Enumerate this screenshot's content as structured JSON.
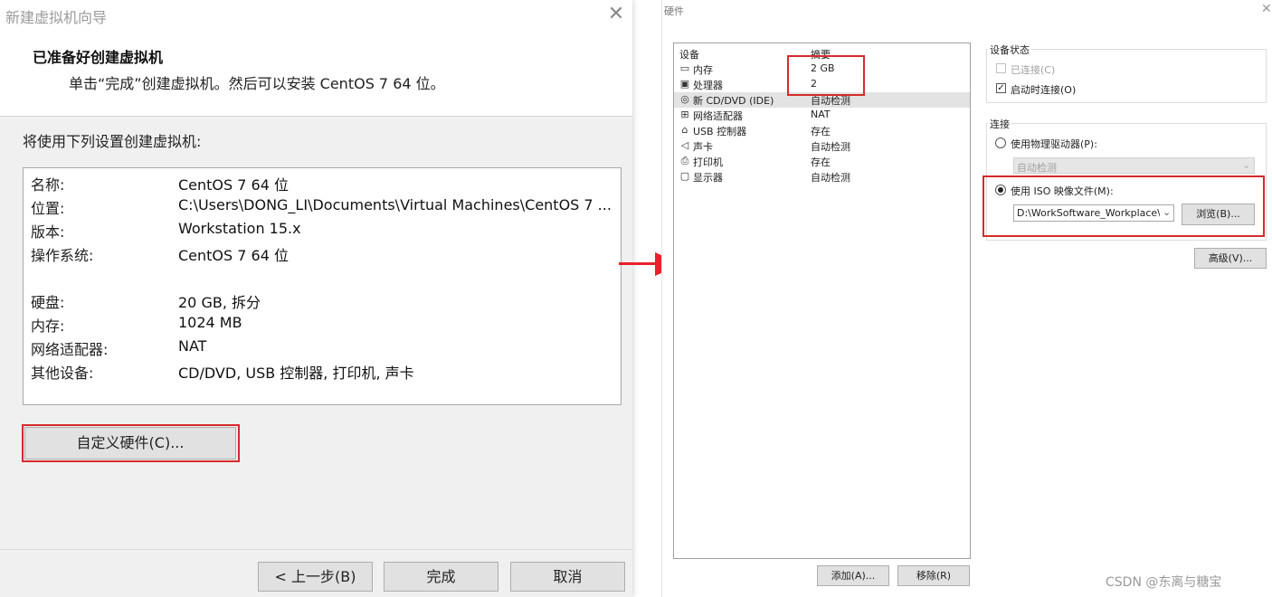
{
  "wizard": {
    "title": "新建虚拟机向导",
    "close_glyph": "✕",
    "heading": "已准备好创建虚拟机",
    "subheading": "单击“完成”创建虚拟机。然后可以安装 CentOS 7 64 位。",
    "intro": "将使用下列设置创建虚拟机:",
    "summary": [
      {
        "label": "名称:",
        "value": "CentOS 7 64 位"
      },
      {
        "label": "位置:",
        "value": "C:\\Users\\DONG_LI\\Documents\\Virtual Machines\\CentOS 7 ..."
      },
      {
        "label": "版本:",
        "value": "Workstation 15.x"
      },
      {
        "label": "操作系统:",
        "value": "CentOS 7 64 位"
      },
      {
        "label": "硬盘:",
        "value": "20 GB, 拆分"
      },
      {
        "label": "内存:",
        "value": "1024 MB"
      },
      {
        "label": "网络适配器:",
        "value": "NAT"
      },
      {
        "label": "其他设备:",
        "value": "CD/DVD, USB 控制器, 打印机, 声卡"
      }
    ],
    "customize_button": "自定义硬件(C)...",
    "back_button": "< 上一步(B)",
    "finish_button": "完成",
    "cancel_button": "取消"
  },
  "hardware": {
    "title": "硬件",
    "close_glyph": "✕",
    "columns": {
      "device": "设备",
      "summary": "摘要"
    },
    "devices": [
      {
        "icon": "memory-icon",
        "glyph": "▭",
        "name": "内存",
        "summary": "2 GB"
      },
      {
        "icon": "processor-icon",
        "glyph": "▣",
        "name": "处理器",
        "summary": "2"
      },
      {
        "icon": "cd-dvd-icon",
        "glyph": "◎",
        "name": "新 CD/DVD (IDE)",
        "summary": "自动检测"
      },
      {
        "icon": "network-adapter-icon",
        "glyph": "⊞",
        "name": "网络适配器",
        "summary": "NAT"
      },
      {
        "icon": "usb-icon",
        "glyph": "⌂",
        "name": "USB 控制器",
        "summary": "存在"
      },
      {
        "icon": "sound-card-icon",
        "glyph": "◁",
        "name": "声卡",
        "summary": "自动检测"
      },
      {
        "icon": "printer-icon",
        "glyph": "⎙",
        "name": "打印机",
        "summary": "存在"
      },
      {
        "icon": "display-icon",
        "glyph": "▢",
        "name": "显示器",
        "summary": "自动检测"
      }
    ],
    "add_button": "添加(A)...",
    "remove_button": "移除(R)",
    "device_status": {
      "group_label": "设备状态",
      "connected_label": "已连接(C)",
      "connected_checked": false,
      "connect_at_power_on_label": "启动时连接(O)",
      "connect_at_power_on_checked": true
    },
    "connection": {
      "group_label": "连接",
      "physical_drive_label": "使用物理驱动器(P):",
      "physical_drive_value": "自动检测",
      "iso_label": "使用 ISO 映像文件(M):",
      "iso_selected": true,
      "iso_path": "D:\\WorkSoftware_Workplace\\I",
      "browse_button": "浏览(B)...",
      "advanced_button": "高级(V)..."
    }
  },
  "watermark": "CSDN @东离与糖宝",
  "colors": {
    "highlight": "#d52b2b",
    "arrow": "#e8222a"
  }
}
